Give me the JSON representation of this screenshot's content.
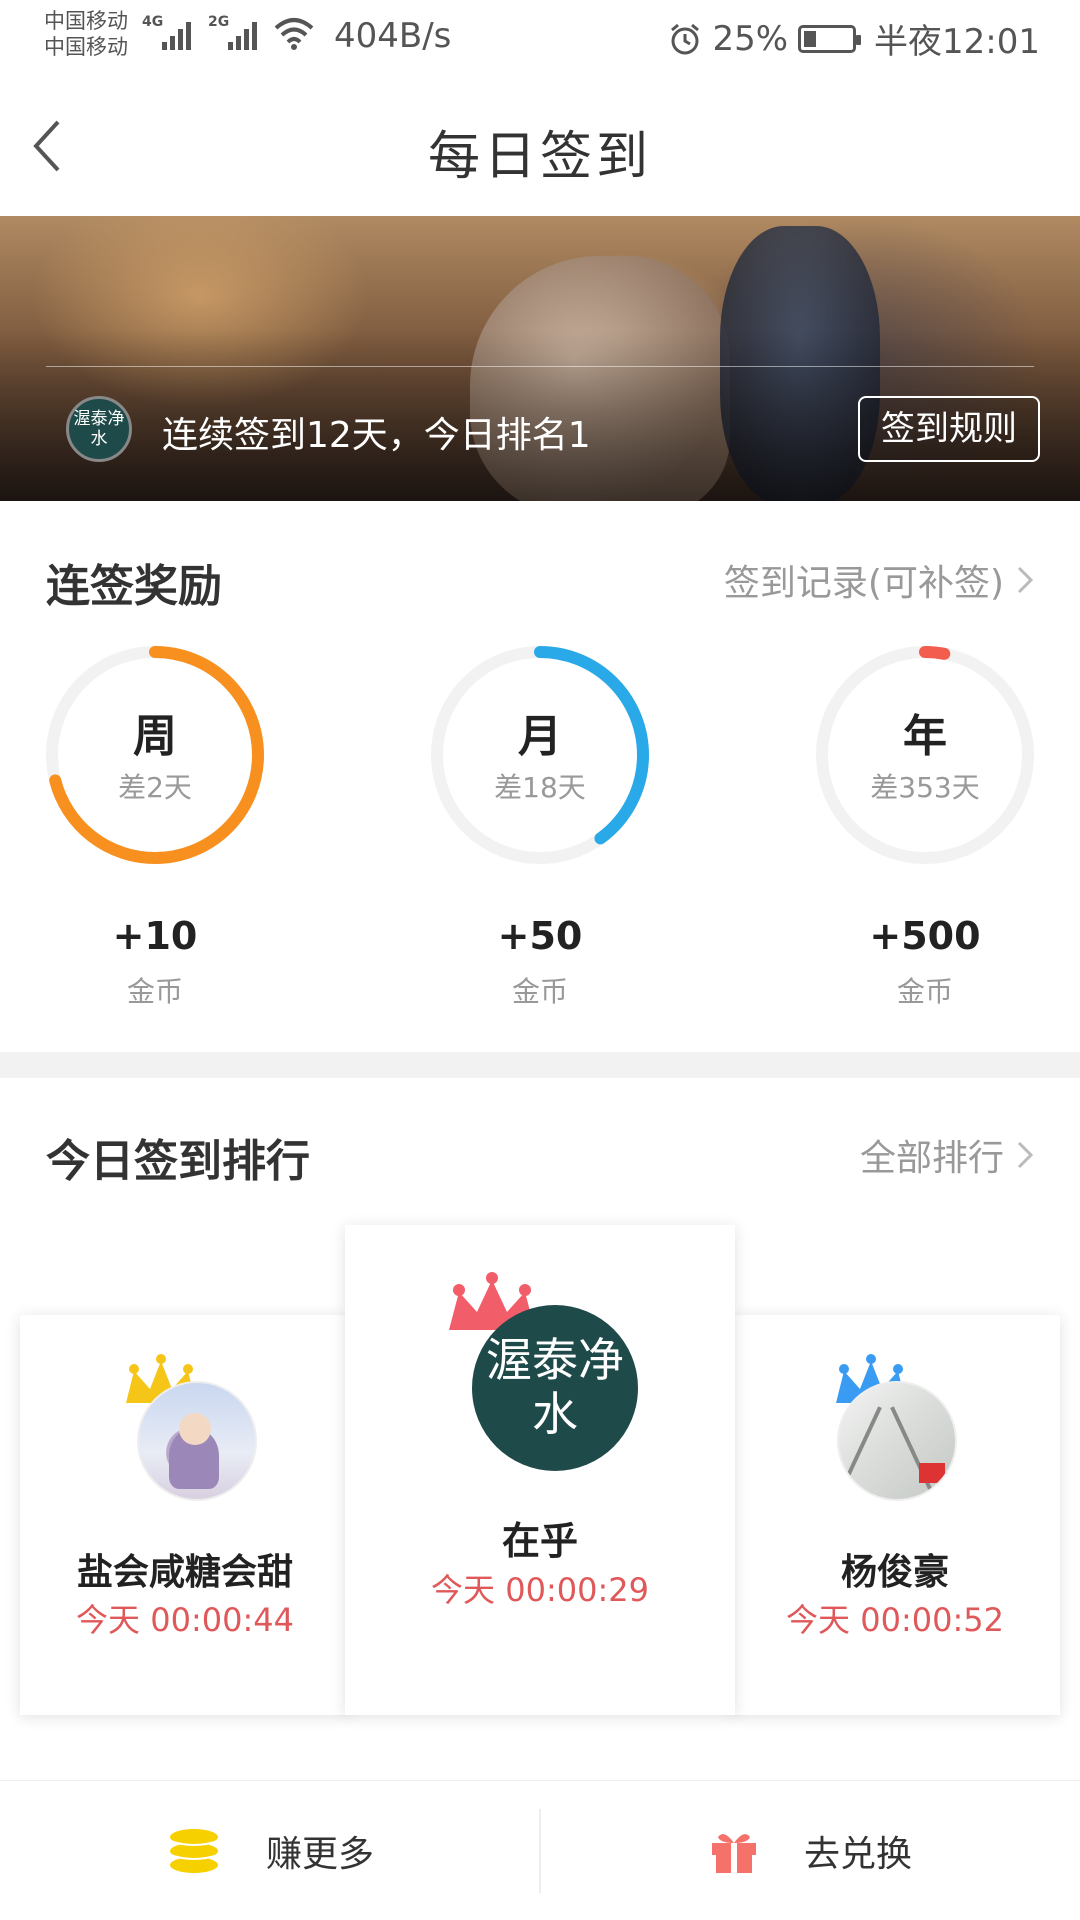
{
  "status_bar": {
    "carrier_1": "中国移动",
    "carrier_2": "中国移动",
    "net_1": "4G",
    "net_2": "2G",
    "net_speed": "404B/s",
    "battery": "25%",
    "battery_level": 0.25,
    "time": "半夜12:01"
  },
  "header": {
    "title": "每日签到"
  },
  "banner": {
    "avatar_text": "渥泰净水",
    "streak_text": "连续签到12天，今日排名1",
    "rules_button": "签到规则"
  },
  "rewards": {
    "title": "连签奖励",
    "link": "签到记录(可补签)",
    "items": [
      {
        "label": "周",
        "sub": "差2天",
        "reward": "+10",
        "unit": "金币",
        "progress": 0.71,
        "color": "#f7901e"
      },
      {
        "label": "月",
        "sub": "差18天",
        "reward": "+50",
        "unit": "金币",
        "progress": 0.4,
        "color": "#2aa9e8"
      },
      {
        "label": "年",
        "sub": "差353天",
        "reward": "+500",
        "unit": "金币",
        "progress": 0.03,
        "color": "#f25d4e"
      }
    ]
  },
  "ranking": {
    "title": "今日签到排行",
    "link": "全部排行",
    "items": [
      {
        "rank": 1,
        "name": "在乎",
        "time": "今天 00:00:29",
        "avatar_text": "渥泰净水",
        "crown_color": "#f25d6a"
      },
      {
        "rank": 2,
        "name": "盐会咸糖会甜",
        "time": "今天 00:00:44",
        "crown_color": "#f5c518"
      },
      {
        "rank": 3,
        "name": "杨俊豪",
        "time": "今天 00:00:52",
        "crown_color": "#3a9bf2"
      }
    ]
  },
  "bottom": {
    "earn_label": "赚更多",
    "exchange_label": "去兑换"
  }
}
